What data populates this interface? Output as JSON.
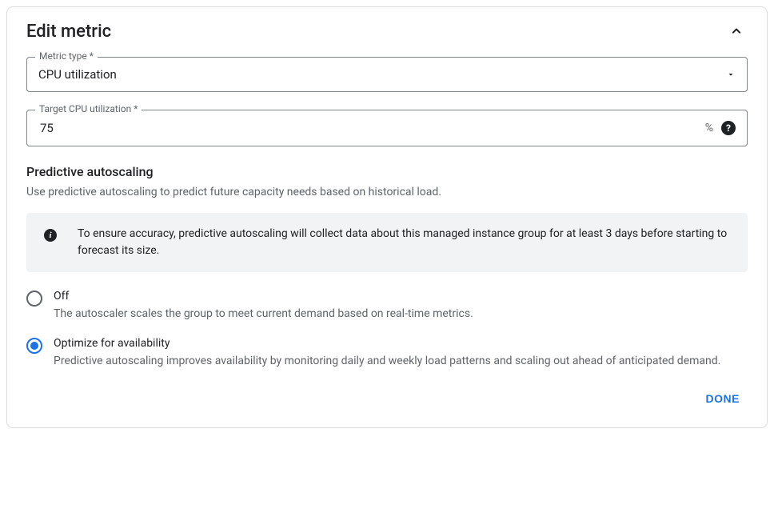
{
  "header": {
    "title": "Edit metric"
  },
  "fields": {
    "metric_type": {
      "label": "Metric type *",
      "value": "CPU utilization"
    },
    "target_cpu": {
      "label": "Target CPU utilization *",
      "value": "75",
      "suffix": "%"
    }
  },
  "predictive": {
    "title": "Predictive autoscaling",
    "description": "Use predictive autoscaling to predict future capacity needs based on historical load.",
    "banner": "To ensure accuracy, predictive autoscaling will collect data about this managed instance group for at least 3 days before starting to forecast its size.",
    "options": {
      "off": {
        "label": "Off",
        "description": "The autoscaler scales the group to meet current demand based on real-time metrics."
      },
      "optimize": {
        "label": "Optimize for availability",
        "description": "Predictive autoscaling improves availability by monitoring daily and weekly load patterns and scaling out ahead of anticipated demand."
      }
    },
    "selected": "optimize"
  },
  "actions": {
    "done": "DONE"
  }
}
